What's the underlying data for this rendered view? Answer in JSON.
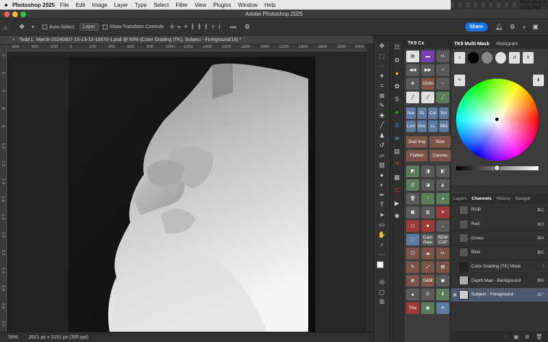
{
  "menubar": {
    "app_name": "Photoshop 2025",
    "items": [
      "File",
      "Edit",
      "Image",
      "Layer",
      "Type",
      "Select",
      "Filter",
      "View",
      "Plugins",
      "Window",
      "Help"
    ],
    "clock": "Mon Aug 4  4:00 PM"
  },
  "window": {
    "title": "Adobe Photoshop 2025"
  },
  "options": {
    "auto_select_label": "Auto-Select:",
    "auto_select_value": "Layer",
    "transform_label": "Show Transform Controls",
    "share_label": "Share"
  },
  "document": {
    "tab_title": "Todd L. Marsh-20240907-15-13-10-15570-1.psd @ 50% (Color Grading (TK), Subject - Foreground/16) *",
    "close_glyph": "×"
  },
  "ruler": {
    "h": [
      "600",
      "400",
      "200",
      "0",
      "200",
      "400",
      "600",
      "800",
      "1000",
      "1200",
      "1400",
      "1600",
      "1800",
      "2000",
      "2200",
      "2400",
      "2600",
      "2800",
      "3000"
    ],
    "v": [
      "0",
      "2",
      "4",
      "6",
      "8",
      "1 0",
      "1 2",
      "1 4",
      "1 6",
      "1 8",
      "2 0",
      "2 2",
      "2 4",
      "2 6",
      "2 8",
      "3 0"
    ]
  },
  "status": {
    "zoom": "50%",
    "doc_info": "2621 px x 3151 px (300 ppi)"
  },
  "tk9": {
    "header": "TK9 Cx",
    "row1": [
      "",
      "",
      "+/-"
    ],
    "zoom_label": "100%",
    "rows_labels": [
      [
        "Nor",
        "SL",
        "Col",
        "Scr"
      ],
      [
        "Lum",
        "OvL",
        "LL",
        "Mul"
      ]
    ],
    "dup_img": "Dup Img",
    "size": "Size",
    "flatten": "Flatten",
    "canvas": "Canvas",
    "cam_raw": "Cam Raw",
    "rem_caf": "REM CAF",
    "plus_minus": "+/-",
    "sam": "S&M",
    "tk_label": "TK▸"
  },
  "multimask": {
    "tab1": "TK9 Multi-Mask",
    "tab2": "Histogram",
    "x_label": "X"
  },
  "panel_tabs": {
    "layers": "Layers",
    "channels": "Channels",
    "history": "History",
    "navigator": "Navigat"
  },
  "channels": [
    {
      "name": "RGB",
      "shortcut": "⌘2"
    },
    {
      "name": "Red",
      "shortcut": "⌘3"
    },
    {
      "name": "Green",
      "shortcut": "⌘4"
    },
    {
      "name": "Blue",
      "shortcut": "⌘5"
    },
    {
      "name": "Color Grading (TK) Mask",
      "shortcut": "\\"
    },
    {
      "name": "Depth Map - Background",
      "shortcut": "⌘6"
    },
    {
      "name": "Subject - Foreground",
      "shortcut": "⌘7"
    }
  ],
  "colors": {
    "accent": "#1473e6",
    "selected_row": "#4d5970"
  }
}
